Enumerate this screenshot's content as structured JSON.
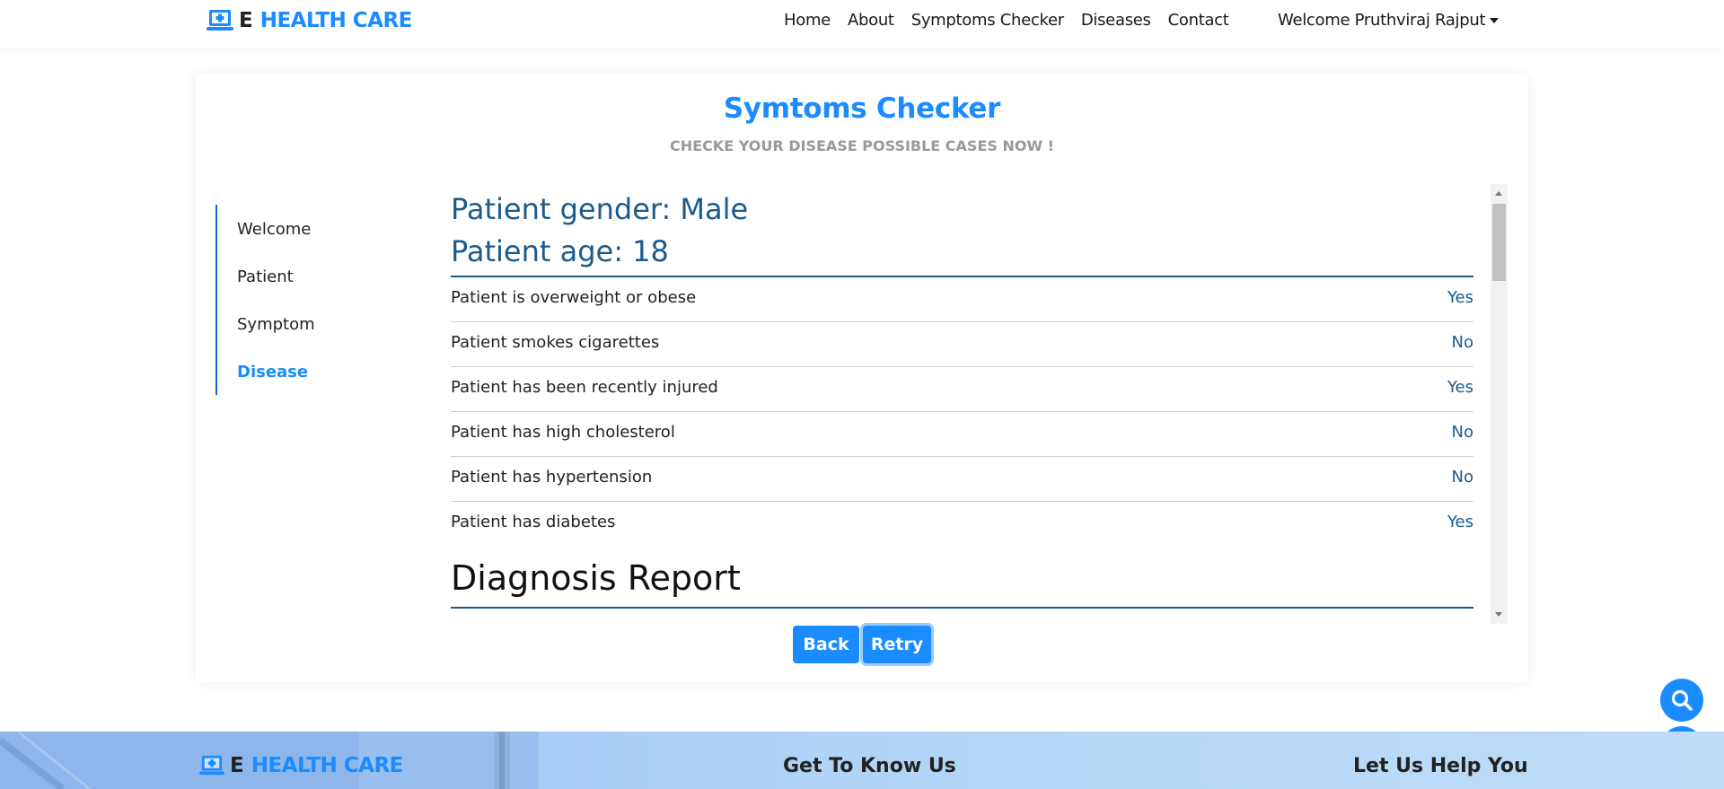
{
  "brand": {
    "e": "E",
    "name": "HEALTH CARE"
  },
  "nav": {
    "links": [
      "Home",
      "About",
      "Symptoms Checker",
      "Diseases",
      "Contact"
    ],
    "user": "Welcome Pruthviraj Rajput"
  },
  "card": {
    "title": "Symtoms Checker",
    "subtitle": "CHECKE YOUR DISEASE POSSIBLE CASES NOW !"
  },
  "steps": [
    {
      "label": "Welcome",
      "active": false
    },
    {
      "label": "Patient",
      "active": false
    },
    {
      "label": "Symptom",
      "active": false
    },
    {
      "label": "Disease",
      "active": true
    }
  ],
  "patient": {
    "gender": "Patient gender: Male",
    "age": "Patient age: 18"
  },
  "questions": [
    {
      "label": "Patient is overweight or obese",
      "answer": "Yes"
    },
    {
      "label": "Patient smokes cigarettes",
      "answer": "No"
    },
    {
      "label": "Patient has been recently injured",
      "answer": "Yes"
    },
    {
      "label": "Patient has high cholesterol",
      "answer": "No"
    },
    {
      "label": "Patient has hypertension",
      "answer": "No"
    },
    {
      "label": "Patient has diabetes",
      "answer": "Yes"
    }
  ],
  "report_heading": "Diagnosis Report",
  "buttons": {
    "back": "Back",
    "retry": "Retry"
  },
  "footer": {
    "brand_e": "E",
    "brand_name": "HEALTH CARE",
    "col2": "Get To Know Us",
    "col3": "Let Us Help You"
  },
  "colors": {
    "accent": "#1a8cff",
    "dark_blue": "#1b5a8c"
  },
  "icons": {
    "fab_top": "search-icon",
    "fab_bottom": "doctor-icon",
    "brand": "medical-laptop-icon"
  }
}
